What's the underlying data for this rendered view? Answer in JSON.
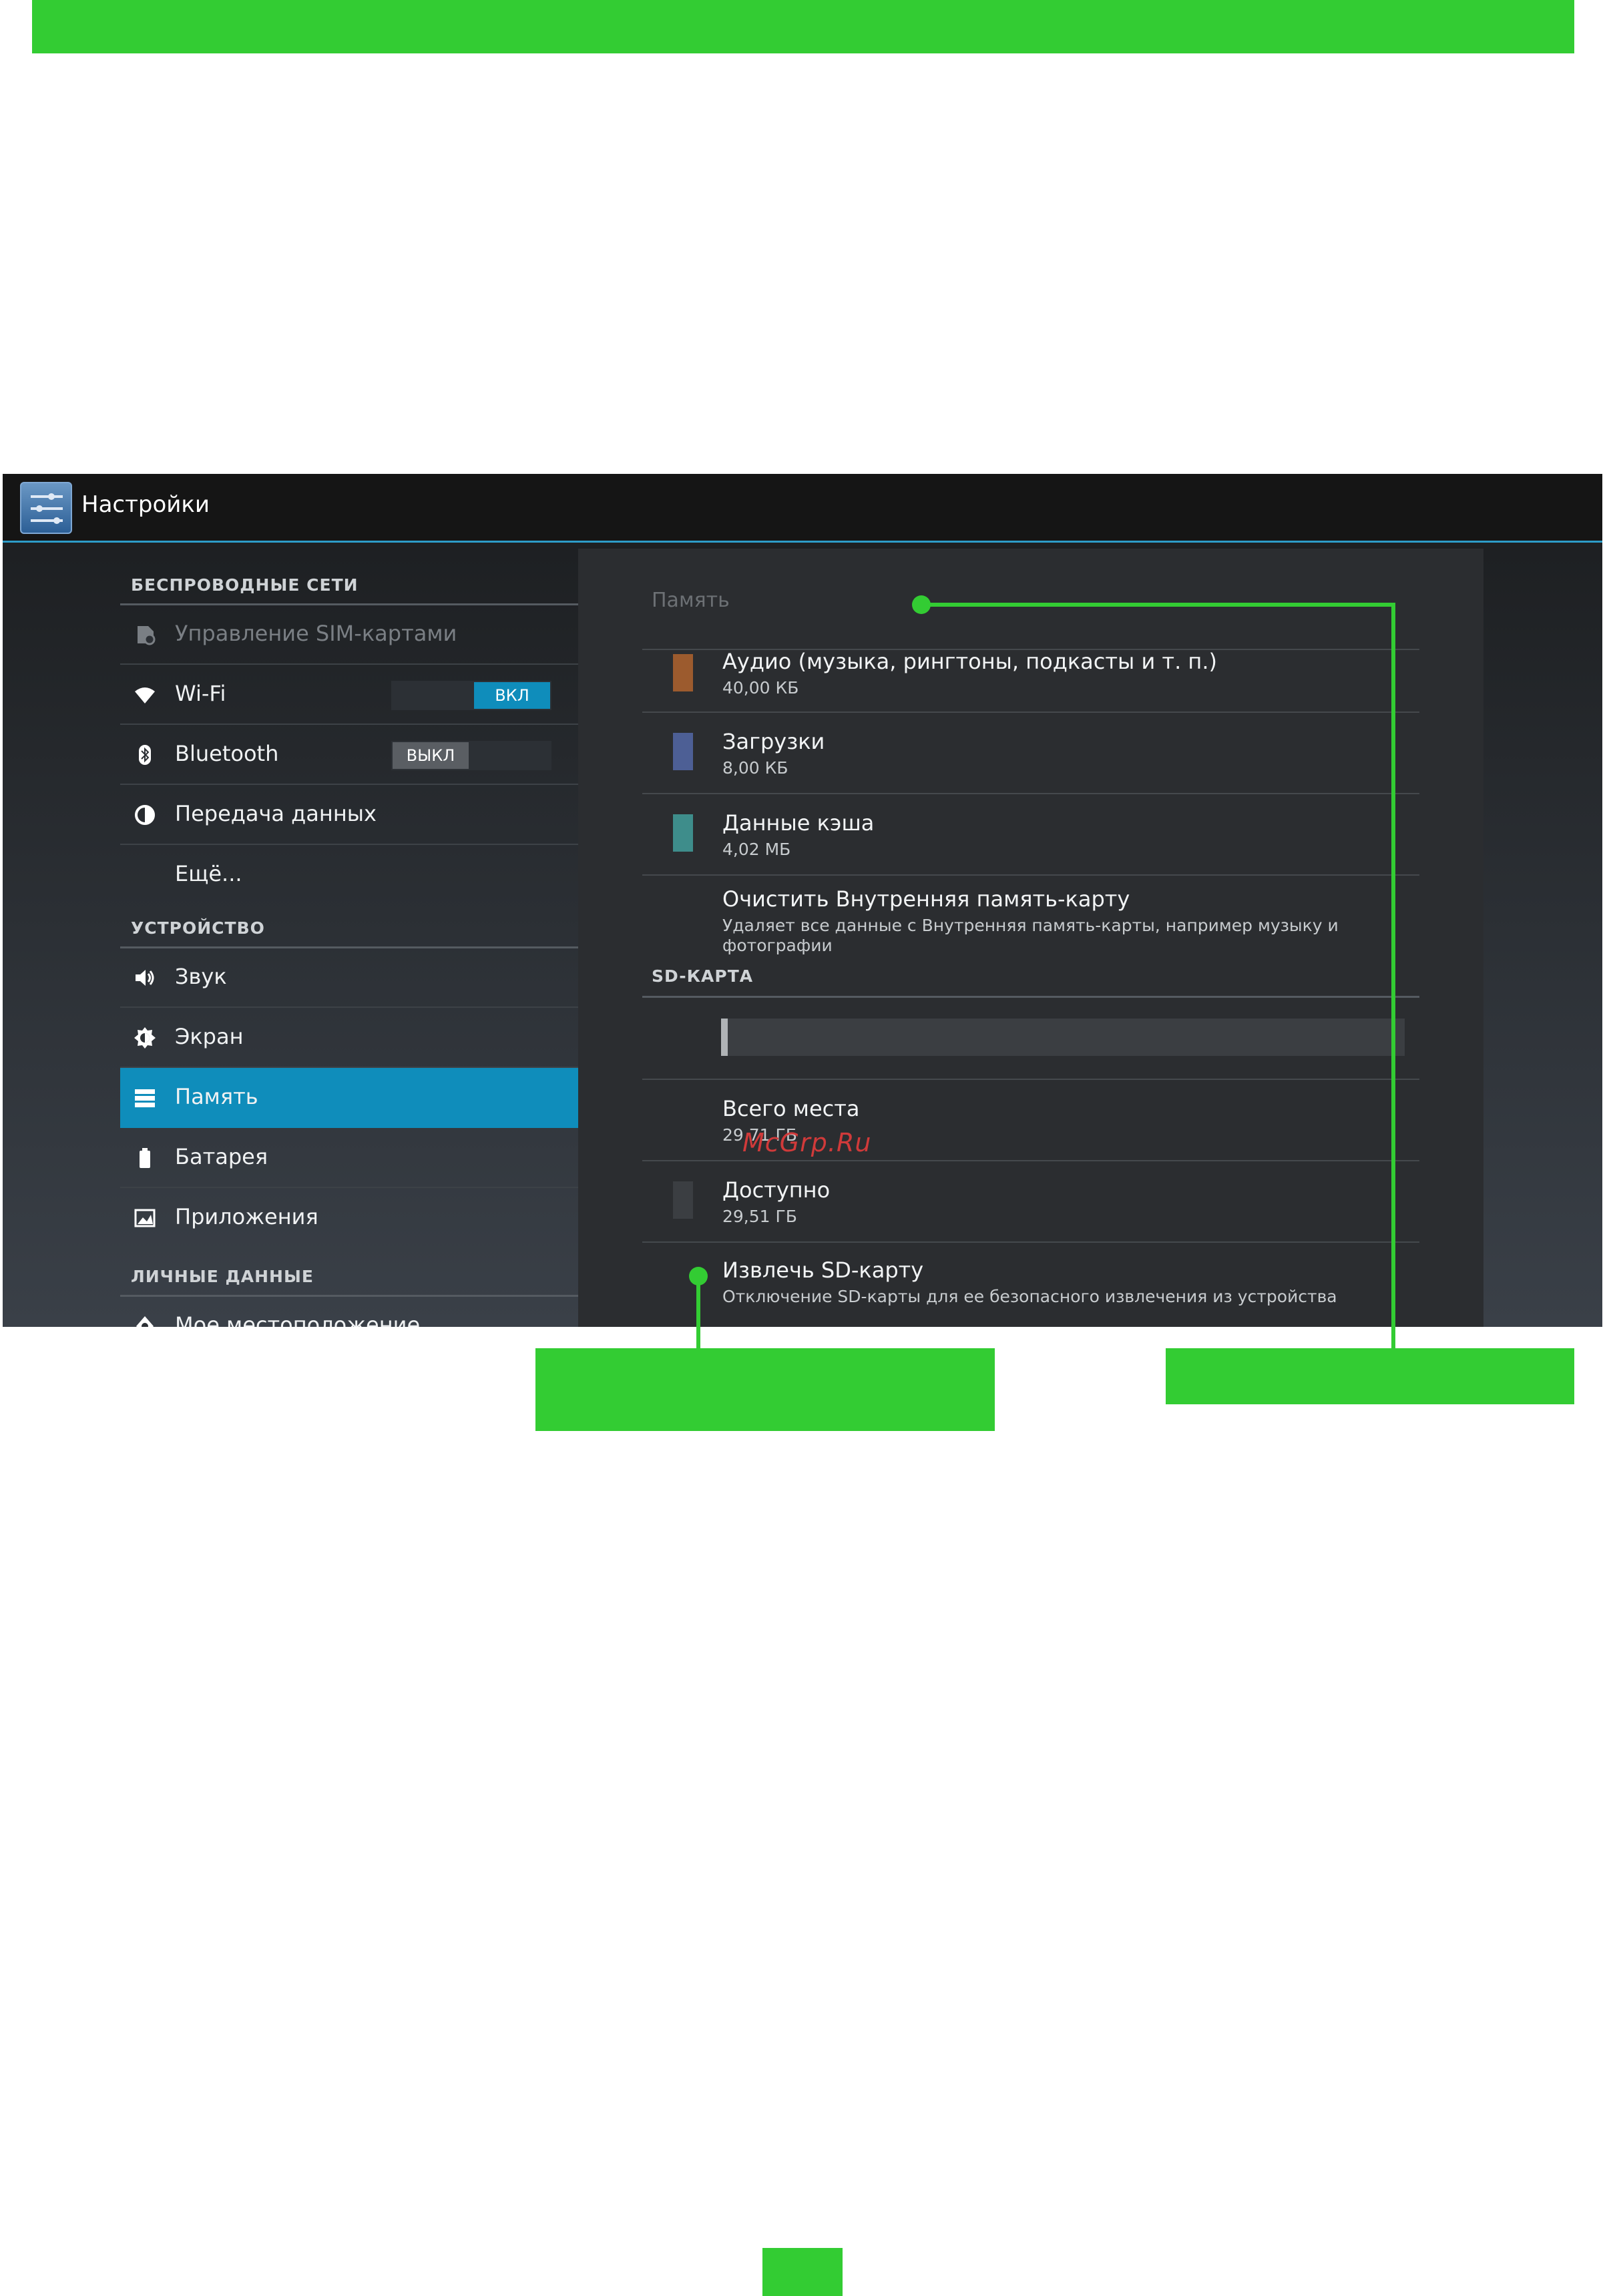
{
  "app": {
    "title": "Настройки",
    "icon": "settings-sliders-icon"
  },
  "sidebar": {
    "sections": [
      {
        "header": "БЕСПРОВОДНЫЕ СЕТИ",
        "items": [
          {
            "label": "Управление SIM-картами",
            "icon": "sim-card-icon",
            "disabled": true
          },
          {
            "label": "Wi-Fi",
            "icon": "wifi-icon",
            "switch": "ВКЛ",
            "switch_state": "on"
          },
          {
            "label": "Bluetooth",
            "icon": "bluetooth-icon",
            "switch": "ВЫКЛ",
            "switch_state": "off"
          },
          {
            "label": "Передача данных",
            "icon": "data-usage-icon"
          },
          {
            "label": "Ещё...",
            "icon": ""
          }
        ]
      },
      {
        "header": "УСТРОЙСТВО",
        "items": [
          {
            "label": "Звук",
            "icon": "speaker-icon"
          },
          {
            "label": "Экран",
            "icon": "brightness-icon"
          },
          {
            "label": "Память",
            "icon": "storage-icon",
            "active": true
          },
          {
            "label": "Батарея",
            "icon": "battery-icon"
          },
          {
            "label": "Приложения",
            "icon": "apps-icon"
          }
        ]
      },
      {
        "header": "ЛИЧНЫЕ ДАННЫЕ",
        "items": [
          {
            "label": "Мое местоположение",
            "icon": "location-icon",
            "partial": true
          }
        ]
      }
    ]
  },
  "panel": {
    "title": "Память",
    "internal_rows": [
      {
        "title": "Аудио (музыка, рингтоны, подкасты и т. п.)",
        "subtitle": "40,00 КБ",
        "color": "#9c5b2e"
      },
      {
        "title": "Загрузки",
        "subtitle": "8,00 КБ",
        "color": "#4d5f95"
      },
      {
        "title": "Данные кэша",
        "subtitle": "4,02 МБ",
        "color": "#3e8d8b"
      }
    ],
    "clear_internal": {
      "title": "Очистить Внутренняя память-карту",
      "subtitle_line1": "Удаляет все данные с Внутренняя память-карты, например музыку и",
      "subtitle_line2": "фотографии"
    },
    "sd_header": "SD-КАРТА",
    "sd_usage_fraction": 0.01,
    "total": {
      "title": "Всего места",
      "subtitle": "29,71 ГБ"
    },
    "available": {
      "title": "Доступно",
      "subtitle": "29,51 ГБ",
      "color": "#3b3e42"
    },
    "eject": {
      "title": "Извлечь SD-карту",
      "subtitle": "Отключение SD-карты для ее безопасного извлечения из устройства"
    }
  },
  "watermark": "McGrp.Ru",
  "colors": {
    "accent_green": "#33cc33",
    "active_blue": "#0f8dbb",
    "switch_on": "#0f8dbb",
    "switch_off": "#5a5e63"
  }
}
